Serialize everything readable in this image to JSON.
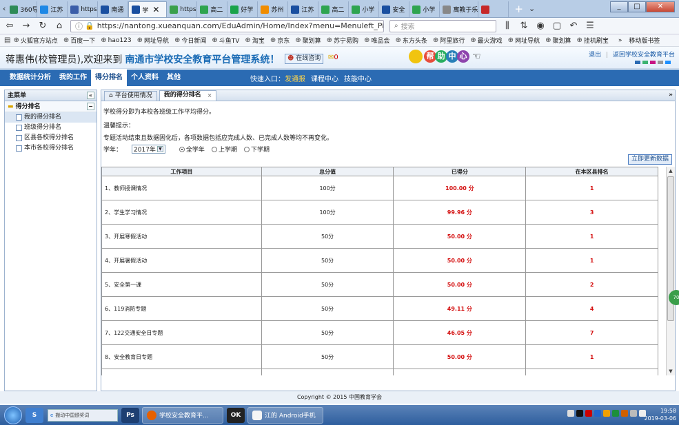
{
  "browser": {
    "tabs": [
      {
        "label": "360导",
        "color": "#2e8b57"
      },
      {
        "label": "江苏",
        "color": "#1e88e5"
      },
      {
        "label": "https",
        "color": "#3a5da8"
      },
      {
        "label": "南通",
        "color": "#1a4fa0"
      },
      {
        "label": "学",
        "color": "#1a4fa0",
        "active": true
      },
      {
        "label": "https",
        "color": "#3aa04b"
      },
      {
        "label": "高二",
        "color": "#2ea44f"
      },
      {
        "label": "好学",
        "color": "#19a34a"
      },
      {
        "label": "苏州",
        "color": "#f08c00"
      },
      {
        "label": "江苏",
        "color": "#1a4fa0"
      },
      {
        "label": "高二",
        "color": "#2ea44f"
      },
      {
        "label": "小学",
        "color": "#2ea44f"
      },
      {
        "label": "安全",
        "color": "#1a4fa0"
      },
      {
        "label": "小学",
        "color": "#2ea44f"
      },
      {
        "label": "寓教于乐",
        "color": "#888888"
      },
      {
        "label": "",
        "color": "#c62828"
      }
    ],
    "tab_close": "✕",
    "url": "https://nantong.xueanquan.com/EduAdmin/Home/Index?menu=Menuleft_Ping",
    "search_placeholder": "搜索",
    "bookmarks": [
      "火狐官方站点",
      "百度一下",
      "hao123",
      "网址导航",
      "今日新闻",
      "斗鱼TV",
      "淘宝",
      "京东",
      "聚划算",
      "苏宁易购",
      "唯品会",
      "东方头条",
      "阿里旅行",
      "最火游戏",
      "网址导航",
      "聚划算",
      "挂机刷宝"
    ],
    "bookmarks_right": "移动版书签"
  },
  "header": {
    "welcome": "蒋惠伟(校管理员),欢迎来到",
    "system_title": "南通市学校安全教育平台管理系统！",
    "consult": "在线咨询",
    "mail_count": "0",
    "help_chars": [
      "帮",
      "助",
      "中",
      "心"
    ],
    "logout": "退出",
    "return_link": "返回学校安全教育平台"
  },
  "menu": {
    "items": [
      "数据统计分析",
      "我的工作",
      "得分排名",
      "个人资料",
      "其他"
    ],
    "active_index": 2,
    "quick_label": "快速入口：",
    "quick_links": [
      "发通报",
      "课程中心",
      "技能中心"
    ]
  },
  "sidebar": {
    "title": "主菜单",
    "group": "得分排名",
    "items": [
      "我的得分排名",
      "班级得分排名",
      "区县各校得分排名",
      "本市各校得分排名"
    ]
  },
  "content": {
    "tabs": [
      "平台使用情况",
      "我的得分排名"
    ],
    "intro": "学校得分即为本校各班级工作平均得分。",
    "tip_label": "温馨提示：",
    "tip_text": "专题活动结束且数据固化后，各项数据包括应完成人数、已完成人数等均不再变化。",
    "year_label": "学年：",
    "year_value": "2017年",
    "terms": [
      "全学年",
      "上学期",
      "下学期"
    ],
    "update_button": "立即更新数据",
    "table": {
      "headers": [
        "工作项目",
        "总分值",
        "已得分",
        "在本区县排名"
      ],
      "rows": [
        [
          "1、教师授课情况",
          "100分",
          "100.00 分",
          "1"
        ],
        [
          "2、学生学习情况",
          "100分",
          "99.96 分",
          "3"
        ],
        [
          "3、开展寒假活动",
          "50分",
          "50.00 分",
          "1"
        ],
        [
          "4、开展暑假活动",
          "50分",
          "50.00 分",
          "1"
        ],
        [
          "5、安全第一课",
          "50分",
          "50.00 分",
          "2"
        ],
        [
          "6、119消防专题",
          "50分",
          "49.11 分",
          "4"
        ],
        [
          "7、122交通安全日专题",
          "50分",
          "46.05 分",
          "7"
        ],
        [
          "8、安全教育日专题",
          "50分",
          "50.00 分",
          "1"
        ]
      ]
    }
  },
  "footer": {
    "copyright": "Copyright © 2015 中国教育学会"
  },
  "side_badge": "70",
  "taskbar": {
    "search_text": "搬动中国颁奖词",
    "tasks": [
      "学校安全教育平...",
      "江的 Android手机"
    ],
    "time": "19:58",
    "date": "2019-03-06"
  }
}
